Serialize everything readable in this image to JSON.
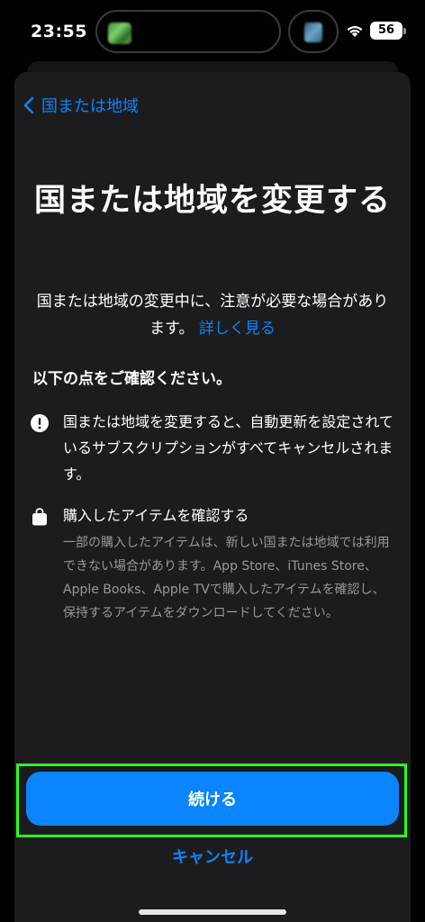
{
  "status": {
    "time": "23:55",
    "battery": "56"
  },
  "nav": {
    "back_label": "国または地域"
  },
  "title": "国または地域を変更する",
  "intro": {
    "text": "国または地域の変更中に、注意が必要な場合があります。",
    "link": "詳しく見る"
  },
  "section_heading": "以下の点をご確認ください。",
  "items": [
    {
      "icon": "exclamation-circle-icon",
      "text": "国または地域を変更すると、自動更新を設定されているサブスクリプションがすべてキャンセルされます。"
    },
    {
      "icon": "shopping-bag-icon",
      "text": "購入したアイテムを確認する",
      "description": "一部の購入したアイテムは、新しい国または地域では利用できない場合があります。App Store、iTunes Store、Apple Books、Apple TVで購入したアイテムを確認し、保持するアイテムをダウンロードしてください。"
    }
  ],
  "buttons": {
    "continue": "続ける",
    "cancel": "キャンセル"
  },
  "colors": {
    "accent": "#0a84ff",
    "sheet": "#1c1c1e",
    "highlight": "#2bff20"
  }
}
